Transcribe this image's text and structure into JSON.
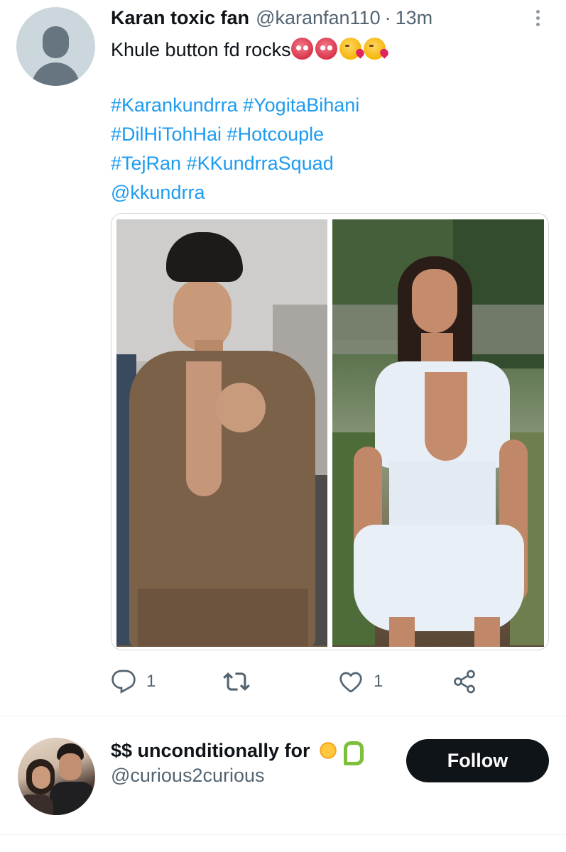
{
  "tweet": {
    "display_name": "Karan toxic fan",
    "handle": "@karanfan110",
    "separator": "·",
    "time": "13m",
    "text": "Khule button fd rocks",
    "emojis": [
      "hot-face",
      "hot-face",
      "face-blowing-kiss",
      "face-blowing-kiss"
    ],
    "hashtags": [
      "#Karankundrra #YogitaBihani",
      "#DilHiTohHai #Hotcouple",
      "#TejRan #KKundrraSquad",
      "@kkundrra"
    ],
    "media": {
      "photos": [
        "photo-man-brown-shirt",
        "photo-woman-floral-dress"
      ]
    },
    "actions": {
      "reply_count": "1",
      "retweet_count": "",
      "like_count": "1"
    }
  },
  "who_to_follow": {
    "display_name": "$$ unconditionally for",
    "name_emojis": [
      "sun-with-face",
      "snake"
    ],
    "handle": "@curious2curious",
    "follow_label": "Follow"
  },
  "colors": {
    "link": "#1d9bf0",
    "secondary_text": "#536471",
    "primary_text": "#0f1419",
    "follow_button": "#0f1419"
  }
}
